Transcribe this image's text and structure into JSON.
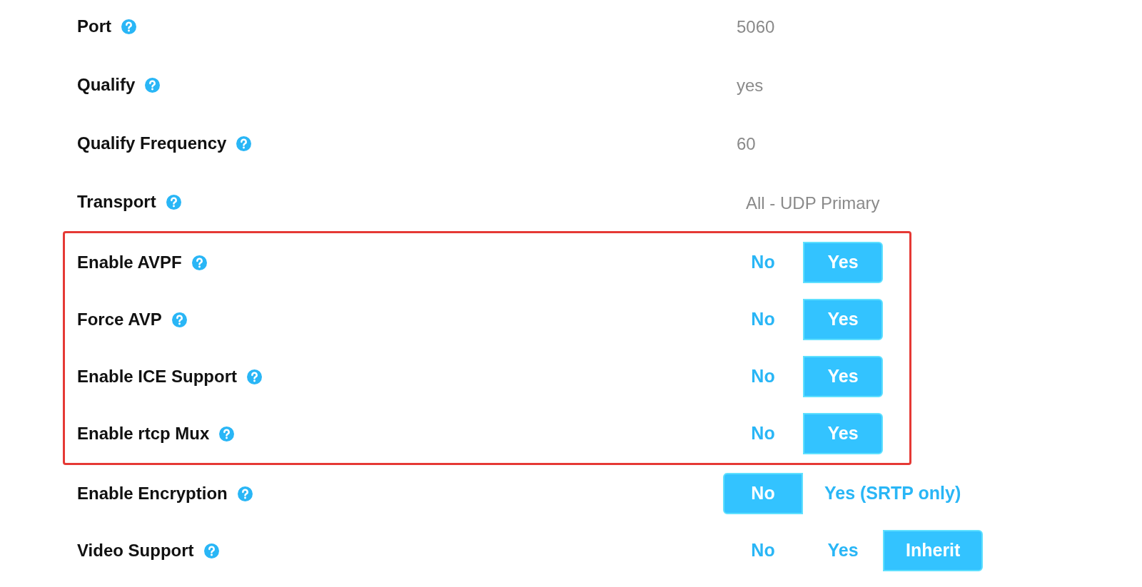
{
  "settings": [
    {
      "kind": "text",
      "label": "Port",
      "value": "5060"
    },
    {
      "kind": "text",
      "label": "Qualify",
      "value": "yes"
    },
    {
      "kind": "text",
      "label": "Qualify Frequency",
      "value": "60"
    },
    {
      "kind": "select",
      "label": "Transport",
      "value": "All - UDP Primary"
    },
    {
      "kind": "group",
      "highlighted": true,
      "rows": [
        {
          "kind": "toggle",
          "label": "Enable AVPF",
          "options": [
            {
              "label": "No",
              "selected": false
            },
            {
              "label": "Yes",
              "selected": true
            }
          ]
        },
        {
          "kind": "toggle",
          "label": "Force AVP",
          "options": [
            {
              "label": "No",
              "selected": false
            },
            {
              "label": "Yes",
              "selected": true
            }
          ]
        },
        {
          "kind": "toggle",
          "label": "Enable ICE Support",
          "options": [
            {
              "label": "No",
              "selected": false
            },
            {
              "label": "Yes",
              "selected": true
            }
          ]
        },
        {
          "kind": "toggle",
          "label": "Enable rtcp Mux",
          "options": [
            {
              "label": "No",
              "selected": false
            },
            {
              "label": "Yes",
              "selected": true
            }
          ]
        }
      ]
    },
    {
      "kind": "toggle",
      "label": "Enable Encryption",
      "options": [
        {
          "label": "No",
          "selected": true
        },
        {
          "label": "Yes (SRTP only)",
          "selected": false
        }
      ]
    },
    {
      "kind": "toggle",
      "label": "Video Support",
      "options": [
        {
          "label": "No",
          "selected": false
        },
        {
          "label": "Yes",
          "selected": false
        },
        {
          "label": "Inherit",
          "selected": true
        }
      ]
    }
  ]
}
